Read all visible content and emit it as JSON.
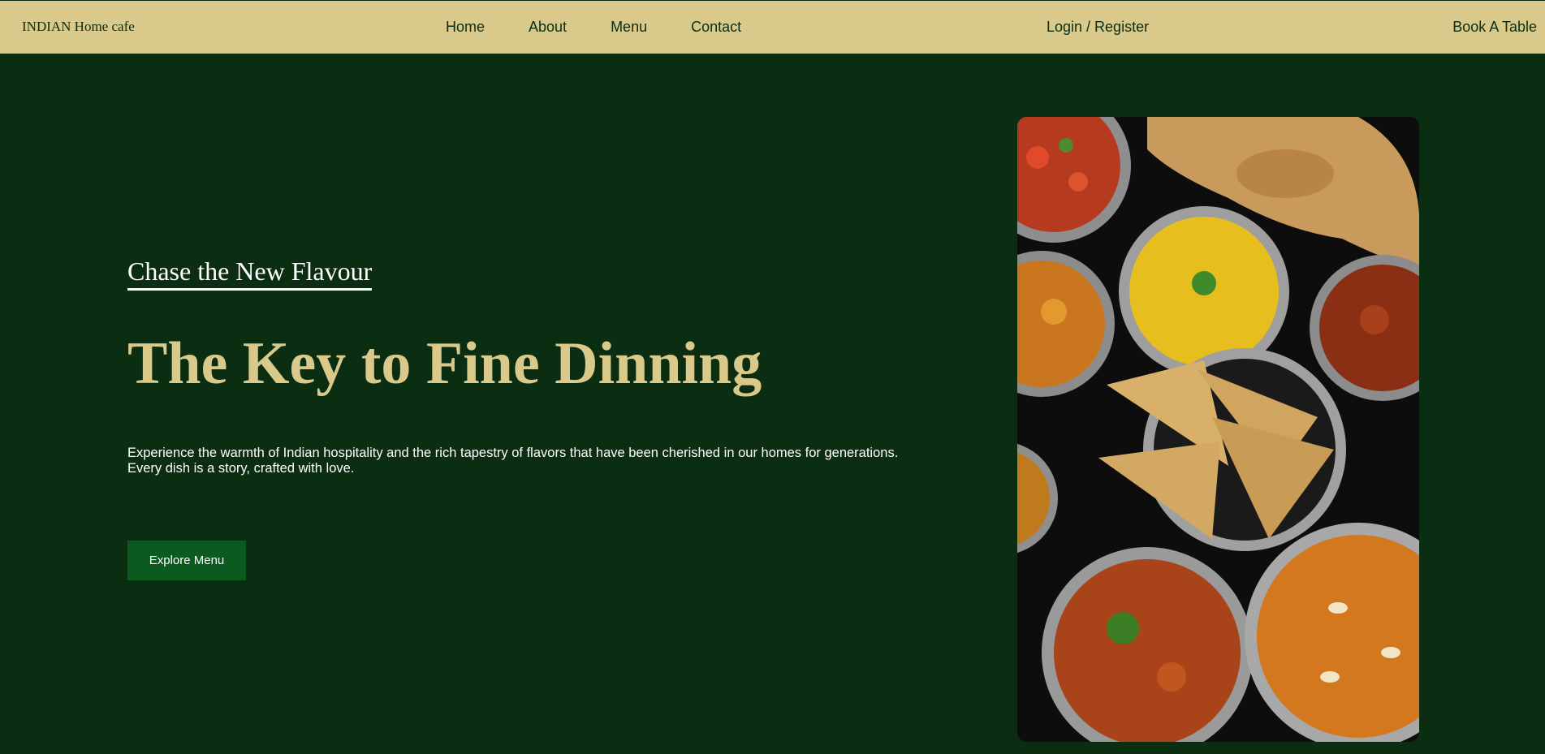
{
  "nav": {
    "brand": "INDIAN Home cafe",
    "links": [
      "Home",
      "About",
      "Menu",
      "Contact"
    ],
    "login": "Login / Register",
    "book": "Book A Table"
  },
  "hero": {
    "subtitle": "Chase the New Flavour",
    "headline": "The Key to Fine Dinning",
    "description_line1": "Experience the warmth of Indian hospitality and the rich tapestry of flavors that have been cherished in our homes for generations.",
    "description_line2": "Every dish is a story, crafted with love.",
    "button": "Explore Menu"
  },
  "colors": {
    "background": "#0b2e13",
    "nav_background": "#d9c98a",
    "accent_gold": "#d9c98a",
    "button": "#0b5a20"
  }
}
